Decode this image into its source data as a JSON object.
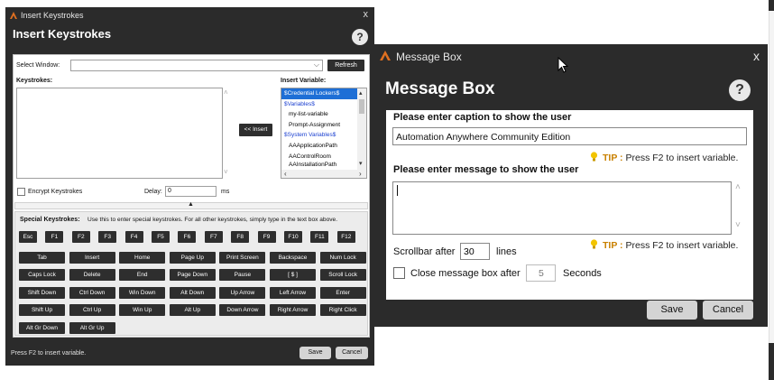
{
  "insert_keystrokes": {
    "window_title": "Insert Keystrokes",
    "header": "Insert Keystrokes",
    "help_label": "?",
    "close_label": "x",
    "select_window_label": "Select Window:",
    "select_window_value": "",
    "refresh_label": "Refresh",
    "keystrokes_label": "Keystrokes:",
    "insert_button_label": "<< Insert",
    "insert_variable_label": "Insert Variable:",
    "variables": [
      "$Credential Lockers$",
      "$Variables$",
      "my-list-variable",
      "Prompt-Assignment",
      "$System Variables$",
      "AAApplicationPath",
      "AAControlRoom",
      "AAInstallationPath"
    ],
    "encrypt_label": "Encrypt Keystrokes",
    "delay_label": "Delay:",
    "delay_value": "0",
    "delay_unit": "ms",
    "special_label": "Special Keystrokes:",
    "special_hint": "Use this to enter special keystrokes. For all other keystrokes, simply type in the text box above.",
    "function_keys": [
      "Esc",
      "F1",
      "F2",
      "F3",
      "F4",
      "F5",
      "F6",
      "F7",
      "F8",
      "F9",
      "F10",
      "F11",
      "F12"
    ],
    "key_rows": [
      [
        "Tab",
        "Insert",
        "Home",
        "Page Up",
        "Print Screen",
        "Backspace",
        "Num Lock"
      ],
      [
        "Caps Lock",
        "Delete",
        "End",
        "Page Down",
        "Pause",
        "[ $ ]",
        "Scroll Lock"
      ],
      [
        "Shift Down",
        "Ctrl Down",
        "Win Down",
        "Alt Down",
        "Up Arrow",
        "Left Arrow",
        "Enter"
      ],
      [
        "Shift Up",
        "Ctrl Up",
        "Win Up",
        "Alt Up",
        "Down Arrow",
        "Right Arrow",
        "Right Click"
      ],
      [
        "Alt Gr Down",
        "Alt Gr Up"
      ]
    ],
    "status_text": "Press F2 to insert variable.",
    "save_label": "Save",
    "cancel_label": "Cancel"
  },
  "message_box": {
    "window_title": "Message Box",
    "header": "Message Box",
    "help_label": "?",
    "close_label": "x",
    "caption_label": "Please enter caption to show the user",
    "caption_value": "Automation Anywhere Community Edition",
    "tip_label": "TIP :",
    "tip_text": "Press F2 to insert variable.",
    "message_label": "Please enter message to show the user",
    "message_value": "",
    "scrollbar_label": "Scrollbar after",
    "scrollbar_value": "30",
    "scrollbar_unit": "lines",
    "close_after_label": "Close message box after",
    "close_after_value": "5",
    "close_after_unit": "Seconds",
    "save_label": "Save",
    "cancel_label": "Cancel"
  },
  "colors": {
    "window_bg": "#2b2b2b",
    "selected_variable_bg": "#1e6fd6",
    "variable_link": "#1a3fd0",
    "tip_accent": "#c98000"
  }
}
